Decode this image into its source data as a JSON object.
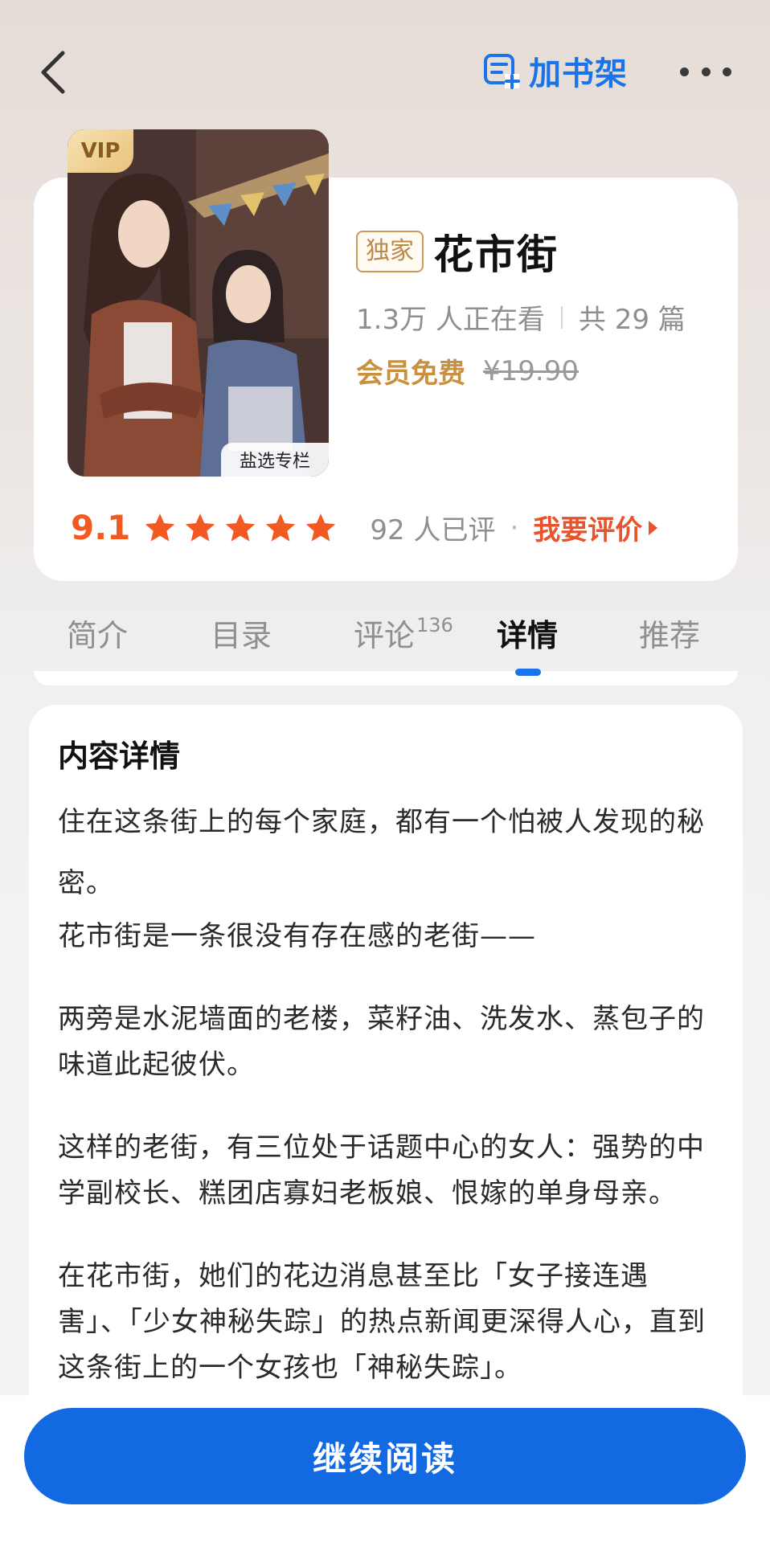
{
  "header": {
    "back_icon": "chevron-left-icon",
    "shelf_icon": "add-to-shelf-icon",
    "shelf_label": "加书架",
    "more_icon": "more-dots-icon",
    "accent_color": "#1a73e8"
  },
  "book": {
    "vip_tag": "VIP",
    "cover_caption": "盐选专栏",
    "exclusive_badge": "独家",
    "title": "花市街",
    "readers": "1.3万 人正在看",
    "chapters": "共 29 篇",
    "member_free": "会员免费",
    "original_price": "¥19.90",
    "score": "9.1",
    "stars": 5,
    "rating_count": "92 人已评",
    "rating_separator": "·",
    "rate_link": "我要评价"
  },
  "tabs": [
    {
      "label": "简介",
      "badge": ""
    },
    {
      "label": "目录",
      "badge": ""
    },
    {
      "label": "评论",
      "badge": "136"
    },
    {
      "label": "详情",
      "badge": "",
      "active": true
    },
    {
      "label": "推荐",
      "badge": ""
    }
  ],
  "content": {
    "section_title": "内容详情",
    "paragraphs": [
      "住在这条街上的每个家庭，都有一个怕被人发现的秘密。",
      "花市街是一条很没有存在感的老街——",
      "两旁是水泥墙面的老楼，菜籽油、洗发水、蒸包子的味道此起彼伏。",
      "这样的老街，有三位处于话题中心的女人：强势的中学副校长、糕团店寡妇老板娘、恨嫁的单身母亲。",
      "在花市街，她们的花边消息甚至比「女子接连遇害」、「少女神秘失踪」的热点新闻更深得人心，直到这条街上的一个女孩也「神秘失踪」。"
    ]
  },
  "footer": {
    "read_button": "继续阅读",
    "button_color": "#1269e2"
  }
}
